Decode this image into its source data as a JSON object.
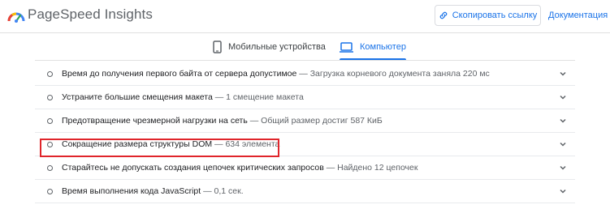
{
  "header": {
    "title": "PageSpeed Insights",
    "copy_link_label": "Скопировать ссылку",
    "docs_label": "Документация",
    "logo_icon": "pagespeed-logo-icon",
    "accent_color": "#1a73e8"
  },
  "tabs": [
    {
      "label": "Мобильные устройства",
      "icon": "smartphone-icon",
      "selected": false
    },
    {
      "label": "Компьютер",
      "icon": "laptop-icon",
      "selected": true
    }
  ],
  "audits": [
    {
      "title": "Время до получения первого байта от сервера допустимое",
      "desc": "— Загрузка корневого документа заняла 220 мс"
    },
    {
      "title": "Устраните большие смещения макета",
      "desc": "— 1 смещение макета"
    },
    {
      "title": "Предотвращение чрезмерной нагрузки на сеть",
      "desc": "— Общий размер достиг 587 КиБ"
    },
    {
      "title": "Сокращение размера структуры DOM",
      "desc": "— 634 элемента",
      "highlighted": true
    },
    {
      "title": "Старайтесь не допускать создания цепочек критических запросов",
      "desc": "— Найдено 12 цепочек"
    },
    {
      "title": "Время выполнения кода JavaScript",
      "desc": "— 0,1 сек."
    }
  ],
  "highlight_color": "#e0252b"
}
